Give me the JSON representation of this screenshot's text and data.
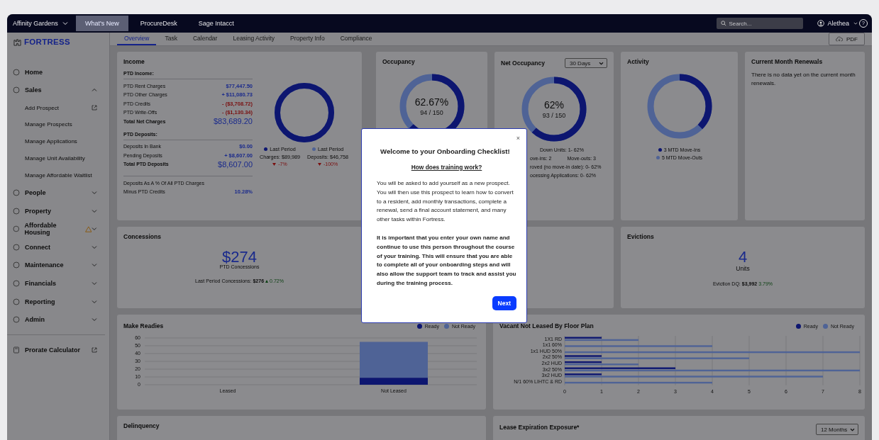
{
  "top_bar": {
    "property": "Affinity Gardens",
    "links": [
      {
        "label": "What's New",
        "selected": true
      },
      {
        "label": "ProcureDesk",
        "selected": false
      },
      {
        "label": "Sage Intacct",
        "selected": false
      }
    ],
    "search": {
      "placeholder": "Search..."
    },
    "user": "Alethea",
    "help": "?"
  },
  "sidebar": {
    "logo": "FORTRESS",
    "items": [
      {
        "label": "Home",
        "kind": "link",
        "warning": false
      },
      {
        "label": "Sales",
        "kind": "group",
        "expanded": true,
        "warning": false,
        "children": [
          {
            "label": "Add Prospect",
            "external": true
          },
          {
            "label": "Manage Prospects",
            "external": false
          },
          {
            "label": "Manage Applications",
            "external": false
          },
          {
            "label": "Manage Unit Availability",
            "external": false
          },
          {
            "label": "Manage Affordable Waitlist",
            "external": false
          }
        ]
      },
      {
        "label": "People",
        "kind": "group",
        "expanded": false,
        "warning": false
      },
      {
        "label": "Property",
        "kind": "group",
        "expanded": false,
        "warning": false
      },
      {
        "label": "Affordable Housing",
        "kind": "group",
        "expanded": false,
        "warning": true
      },
      {
        "label": "Connect",
        "kind": "group",
        "expanded": false,
        "warning": false
      },
      {
        "label": "Maintenance",
        "kind": "group",
        "expanded": false,
        "warning": false
      },
      {
        "label": "Financials",
        "kind": "group",
        "expanded": false,
        "warning": false
      },
      {
        "label": "Reporting",
        "kind": "group",
        "expanded": false,
        "warning": false
      },
      {
        "label": "Admin",
        "kind": "group",
        "expanded": false,
        "warning": false
      }
    ],
    "footer": [
      {
        "label": "Prorate Calculator",
        "external": true
      }
    ]
  },
  "tabs": [
    {
      "label": "Overview",
      "selected": true
    },
    {
      "label": "Task",
      "selected": false
    },
    {
      "label": "Calendar",
      "selected": false
    },
    {
      "label": "Leasing Activity",
      "selected": false
    },
    {
      "label": "Property Info",
      "selected": false
    },
    {
      "label": "Compliance",
      "selected": false
    }
  ],
  "pdf_button": "PDF",
  "income": {
    "title": "Income",
    "sections": [
      {
        "heading": "PTD Income:",
        "rows": [
          {
            "label": "PTD Rent Charges",
            "value": "$77,447.50",
            "color": "#1a2a8c",
            "total": false
          },
          {
            "label": "PTD Other Charges",
            "value": "+ $11,080.73",
            "color": "#1a2a8c",
            "total": false
          },
          {
            "label": "PTD Credits",
            "value": "- ($3,708.72)",
            "color": "#7a0f0f",
            "total": false
          },
          {
            "label": "PTD Write-Offs",
            "value": "- ($1,130.34)",
            "color": "#7a0f0f",
            "total": false
          },
          {
            "label": "Total Net Charges",
            "value": "$83,689.20",
            "color": "#1a2a8c",
            "total": true
          }
        ]
      },
      {
        "heading": "PTD Deposits:",
        "rows": [
          {
            "label": "Deposits In Bank",
            "value": "$0.00",
            "color": "#1a2a8c",
            "total": false
          },
          {
            "label": "Pending Deposits",
            "value": "+ $8,607.00",
            "color": "#1a2a8c",
            "total": false
          },
          {
            "label": "Total PTD Deposits",
            "value": "$8,607.00",
            "color": "#1a2a8c",
            "total": true
          }
        ]
      }
    ],
    "footer_rows": [
      {
        "label": "Deposits As A % Of All PTD Charges"
      },
      {
        "label": "Minus PTD Credits",
        "value": "10.28%"
      }
    ],
    "legend": [
      {
        "label": "Last Period",
        "detail": "Charges: $89,989",
        "change": "-7%",
        "color": "#0d1670"
      },
      {
        "label": "Last Period",
        "detail": "Deposits: $46,758",
        "change": "-100%",
        "color": "#4f6396"
      }
    ]
  },
  "occupancy": {
    "title": "Occupancy",
    "percent": "62.67%",
    "count": "94 / 150"
  },
  "net_occupancy": {
    "title": "Net Occupancy",
    "period": "30 Days",
    "percent": "62%",
    "count": "93 / 150",
    "details": [
      "Down Units: 1- 62%",
      "ove-ins: 2",
      "Move-outs: 3",
      "roved (no move-in date): 0- 62%",
      "ocessing Applications: 0- 62%"
    ]
  },
  "activity": {
    "title": "Activity",
    "legend": [
      {
        "label": "3 MTD Move-Ins",
        "color": "#0d1670"
      },
      {
        "label": "5 MTD Move-Outs",
        "color": "#4f6396"
      }
    ]
  },
  "renewals": {
    "title": "Current Month Renewals",
    "message": "There is no data yet on the current month renewals."
  },
  "concessions": {
    "title": "Concessions",
    "amount": "$274",
    "caption": "PTD Concessions",
    "last_period": "Last Period Concessions:",
    "last_value": "$276",
    "change": "0.72%"
  },
  "evictions": {
    "title": "Evictions",
    "count": "4",
    "unit": "Units",
    "label": "Eviction DQ:",
    "value": "$3,992",
    "change": "3.79%"
  },
  "make_readies": {
    "title": "Make Readies",
    "chart_data": {
      "type": "bar",
      "stacked": true,
      "grid": true,
      "categories": [
        "Leased",
        "Not Leased"
      ],
      "ylim": [
        0,
        60
      ],
      "yticks": [
        0,
        10,
        20,
        30,
        40,
        50,
        60
      ],
      "series": [
        {
          "name": "Ready",
          "color": "#0d1670",
          "values": [
            0,
            9
          ]
        },
        {
          "name": "Not Ready",
          "color": "#4f6396",
          "values": [
            0,
            46
          ]
        }
      ]
    }
  },
  "vacant": {
    "title": "Vacant Not Leased By Floor Plan",
    "chart_data": {
      "type": "bar",
      "orientation": "horizontal",
      "grid": true,
      "categories": [
        "1X1 RD",
        "1x1 60%",
        "1x1 HUD 50%",
        "2x2 50%",
        "2x2 HUD",
        "3x2 50%",
        "3x2 HUD",
        "N/1 60% LIHTC & RD"
      ],
      "xlim": [
        0,
        8
      ],
      "xticks": [
        0,
        1,
        2,
        3,
        4,
        5,
        6,
        7,
        8
      ],
      "series": [
        {
          "name": "Ready",
          "color": "#0d1670",
          "values": [
            1,
            0,
            0,
            1,
            1,
            3,
            1,
            0
          ]
        },
        {
          "name": "Not Ready",
          "color": "#4f6396",
          "values": [
            2,
            4,
            8,
            5,
            2,
            8,
            7,
            4
          ]
        }
      ]
    }
  },
  "delinquency": {
    "title": "Delinquency"
  },
  "lease_expiration": {
    "title": "Lease Expiration Exposure*",
    "period": "12 Months"
  },
  "modal": {
    "close": "×",
    "title": "Welcome to your Onboarding Checklist!",
    "subtitle": "How does training work?",
    "body": "You will be asked to add yourself as a new prospect. You will then use this prospect to learn how to convert to a resident, add monthly transactions, complete a renewal, send a final account statement, and many other tasks within Fortress.",
    "emphasis": "It is important that you enter your own name and continue to use this person throughout the course of your training. This will ensure that you are able to complete all of your onboarding steps and will also allow the support team to track and assist you during the training process.",
    "button": "Next"
  }
}
